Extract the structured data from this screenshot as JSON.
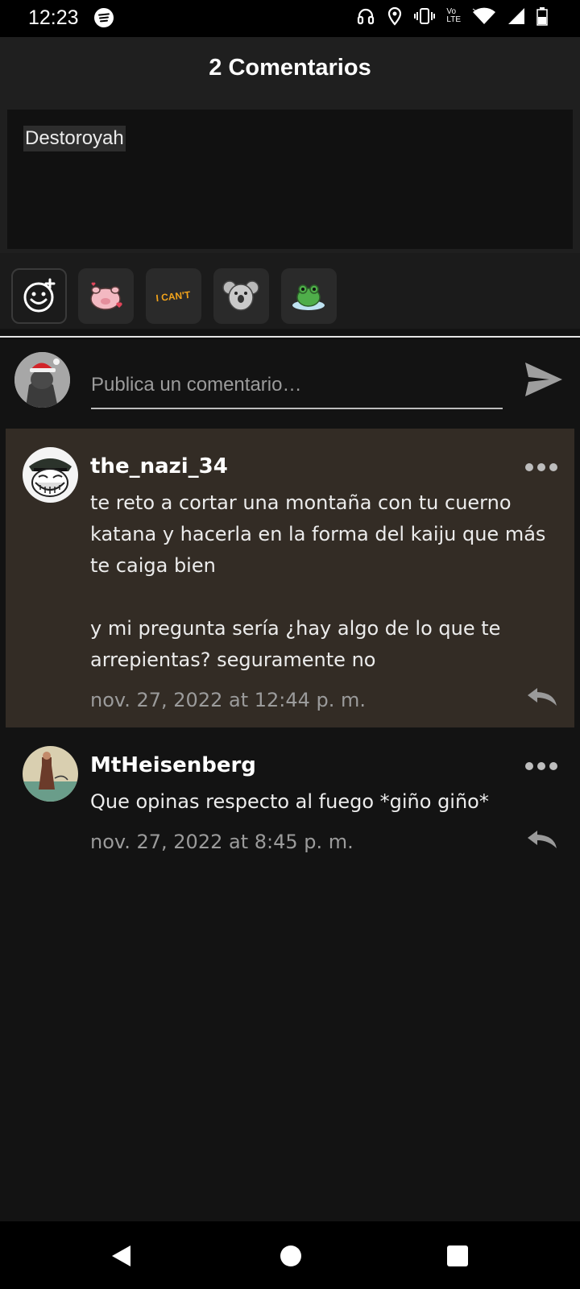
{
  "status_bar": {
    "time": "12:23",
    "volte_line1": "Vo",
    "volte_line2": "LTE",
    "icons": [
      "spotify-icon",
      "headphones-icon",
      "location-icon",
      "vibrate-icon",
      "volte-icon",
      "wifi-icon",
      "signal-icon",
      "battery-icon"
    ]
  },
  "header": {
    "title": "2 Comentarios"
  },
  "editor": {
    "text": "Destoroyah"
  },
  "sticker_bar": {
    "items": [
      "emoji-add-icon",
      "pig-sticker",
      "i-cant-sticker",
      "koala-sticker",
      "frog-sticker"
    ],
    "i_cant_text": "I CAN'T"
  },
  "composer": {
    "placeholder": "Publica un comentario…"
  },
  "comments": [
    {
      "username": "the_nazi_34",
      "text": "te reto a cortar una montaña con tu cuerno katana y hacerla en la forma del kaiju que más te caiga bien\n\ny mi pregunta sería ¿hay algo de lo que te arrepientas? seguramente no",
      "date": "nov. 27, 2022 at 12:44 p. m."
    },
    {
      "username": "MtHeisenberg",
      "text": "Que opinas respecto al fuego *giño giño*",
      "date": "nov. 27, 2022 at 8:45 p. m."
    }
  ],
  "colors": {
    "background": "#131313",
    "header": "#1f1f1f",
    "highlight_comment": "#332c25",
    "muted_text": "#9b9b9b"
  }
}
